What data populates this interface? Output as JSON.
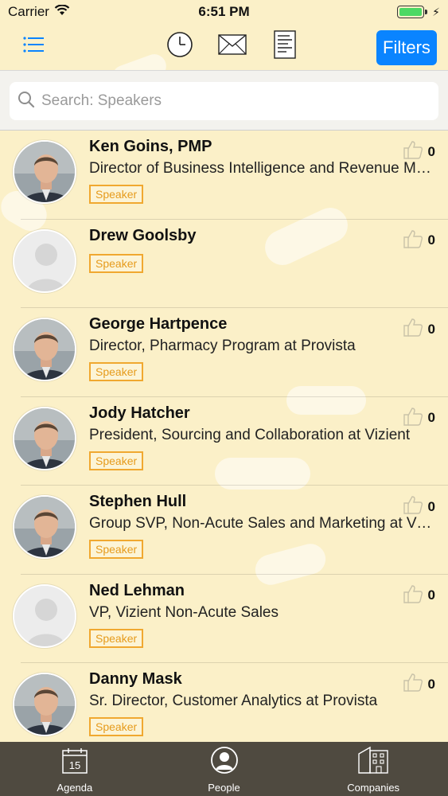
{
  "status": {
    "carrier": "Carrier",
    "time": "6:51 PM"
  },
  "nav": {
    "filters_label": "Filters"
  },
  "search": {
    "placeholder": "Search: Speakers",
    "value": ""
  },
  "speakers": [
    {
      "name": "Ken Goins, PMP",
      "title": "Director of Business Intelligence and Revenue Management",
      "badge": "Speaker",
      "likes": "0",
      "photo": "photo"
    },
    {
      "name": "Drew Goolsby",
      "title": "",
      "badge": "Speaker",
      "likes": "0",
      "photo": "placeholder"
    },
    {
      "name": "George Hartpence",
      "title": "Director, Pharmacy Program at Provista",
      "badge": "Speaker",
      "likes": "0",
      "photo": "photo"
    },
    {
      "name": "Jody Hatcher",
      "title": "President, Sourcing and Collaboration at Vizient",
      "badge": "Speaker",
      "likes": "0",
      "photo": "photo"
    },
    {
      "name": "Stephen Hull",
      "title": "Group SVP, Non-Acute Sales and Marketing at Vizient",
      "badge": "Speaker",
      "likes": "0",
      "photo": "photo"
    },
    {
      "name": "Ned Lehman",
      "title": "VP, Vizient Non-Acute Sales",
      "badge": "Speaker",
      "likes": "0",
      "photo": "placeholder"
    },
    {
      "name": "Danny Mask",
      "title": "Sr. Director, Customer Analytics at Provista",
      "badge": "Speaker",
      "likes": "0",
      "photo": "photo"
    }
  ],
  "tabs": [
    {
      "label": "Agenda",
      "icon": "calendar-icon",
      "day": "15"
    },
    {
      "label": "People",
      "icon": "person-icon"
    },
    {
      "label": "Companies",
      "icon": "building-icon"
    }
  ],
  "colors": {
    "background": "#fbf0c8",
    "accent": "#0a84ff",
    "badge": "#f0a830",
    "tab_bar": "#4f4a40"
  }
}
